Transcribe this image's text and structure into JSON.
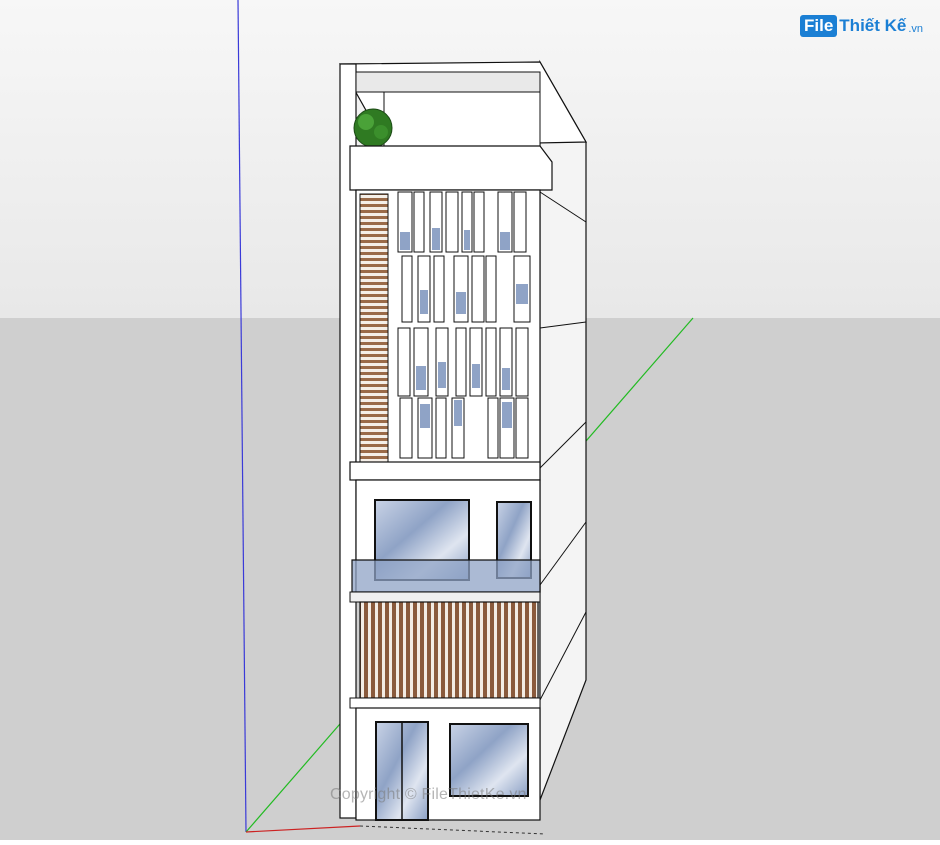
{
  "logo": {
    "badge": "File",
    "text": "Thiết Kế",
    "domain": ".vn"
  },
  "watermark": {
    "text": "Copyright © FileThietKe.vn"
  },
  "colors": {
    "sky": "#eeeeee",
    "ground": "#cfcfcf",
    "axis_blue": "#3a3ad8",
    "axis_green": "#22bb22",
    "axis_red": "#cc2222",
    "wood": "#8a5a3c",
    "glass": "#8fa6c6",
    "wall_front": "#ffffff",
    "wall_side": "#f4f4f4",
    "brand": "#1b7fd4"
  },
  "model": {
    "icon": "townhouse-3d-model"
  }
}
